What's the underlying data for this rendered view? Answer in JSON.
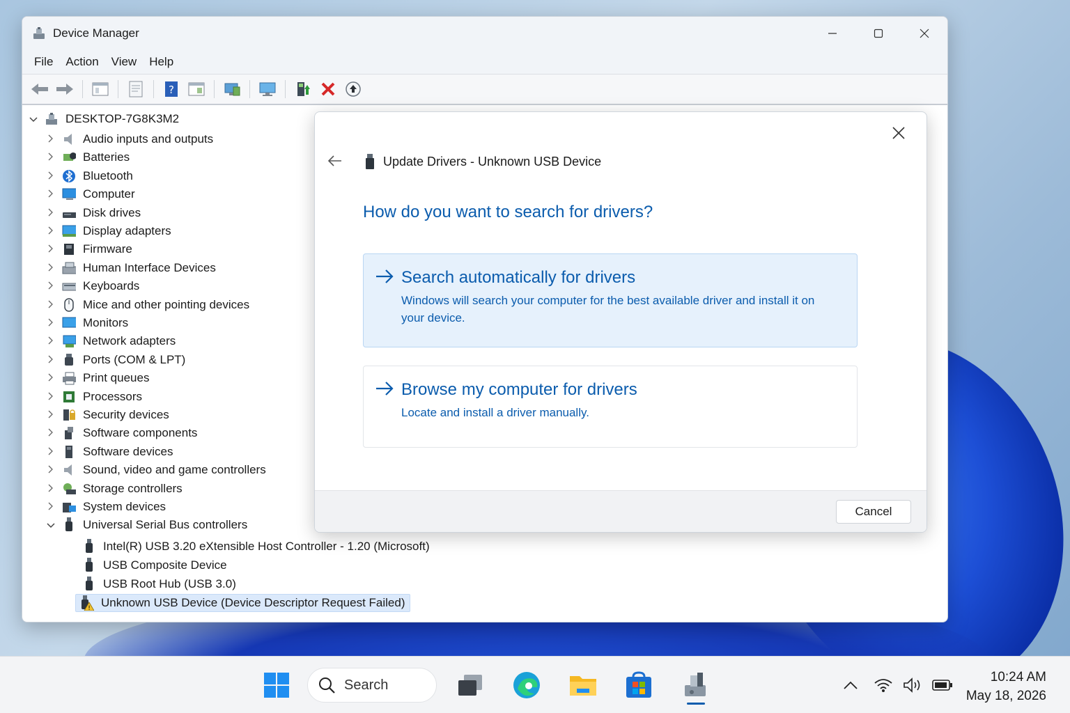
{
  "window": {
    "title": "Device Manager",
    "menu": [
      "File",
      "Action",
      "View",
      "Help"
    ]
  },
  "tree": {
    "root": "DESKTOP-7G8K3M2",
    "categories": [
      {
        "label": "Audio inputs and outputs",
        "icon": "speaker-icon"
      },
      {
        "label": "Batteries",
        "icon": "battery-icon"
      },
      {
        "label": "Bluetooth",
        "icon": "bluetooth-icon"
      },
      {
        "label": "Computer",
        "icon": "computer-icon"
      },
      {
        "label": "Disk drives",
        "icon": "disk-icon"
      },
      {
        "label": "Display adapters",
        "icon": "display-adapter-icon"
      },
      {
        "label": "Firmware",
        "icon": "firmware-icon"
      },
      {
        "label": "Human Interface Devices",
        "icon": "hid-icon"
      },
      {
        "label": "Keyboards",
        "icon": "keyboard-icon"
      },
      {
        "label": "Mice and other pointing devices",
        "icon": "mouse-icon"
      },
      {
        "label": "Monitors",
        "icon": "monitor-icon"
      },
      {
        "label": "Network adapters",
        "icon": "network-icon"
      },
      {
        "label": "Ports (COM & LPT)",
        "icon": "port-icon"
      },
      {
        "label": "Print queues",
        "icon": "printer-icon"
      },
      {
        "label": "Processors",
        "icon": "processor-icon"
      },
      {
        "label": "Security devices",
        "icon": "security-icon"
      },
      {
        "label": "Software components",
        "icon": "software-component-icon"
      },
      {
        "label": "Software devices",
        "icon": "software-device-icon"
      },
      {
        "label": "Sound, video and game controllers",
        "icon": "sound-icon"
      },
      {
        "label": "Storage controllers",
        "icon": "storage-icon"
      },
      {
        "label": "System devices",
        "icon": "system-icon"
      },
      {
        "label": "Universal Serial Bus controllers",
        "icon": "usb-icon"
      }
    ],
    "usb_children": [
      "Intel(R) USB 3.20 eXtensible Host Controller - 1.20 (Microsoft)",
      "USB Composite Device",
      "USB Root Hub (USB 3.0)",
      "Unknown USB Device (Device Descriptor Request Failed)"
    ]
  },
  "dialog": {
    "title": "Update Drivers - Unknown USB Device",
    "question": "How do you want to search for drivers?",
    "option1_title": "Search automatically for drivers",
    "option1_desc": "Windows will search your computer for the best available driver and install it on your device.",
    "option2_title": "Browse my computer for drivers",
    "option2_desc": "Locate and install a driver manually.",
    "cancel": "Cancel"
  },
  "taskbar": {
    "search": "Search",
    "time": "10:24 AM",
    "date": "May 18, 2026"
  },
  "colors": {
    "accent": "#0b5cad",
    "selection": "#dbe9fb",
    "error_red": "#d62828"
  }
}
